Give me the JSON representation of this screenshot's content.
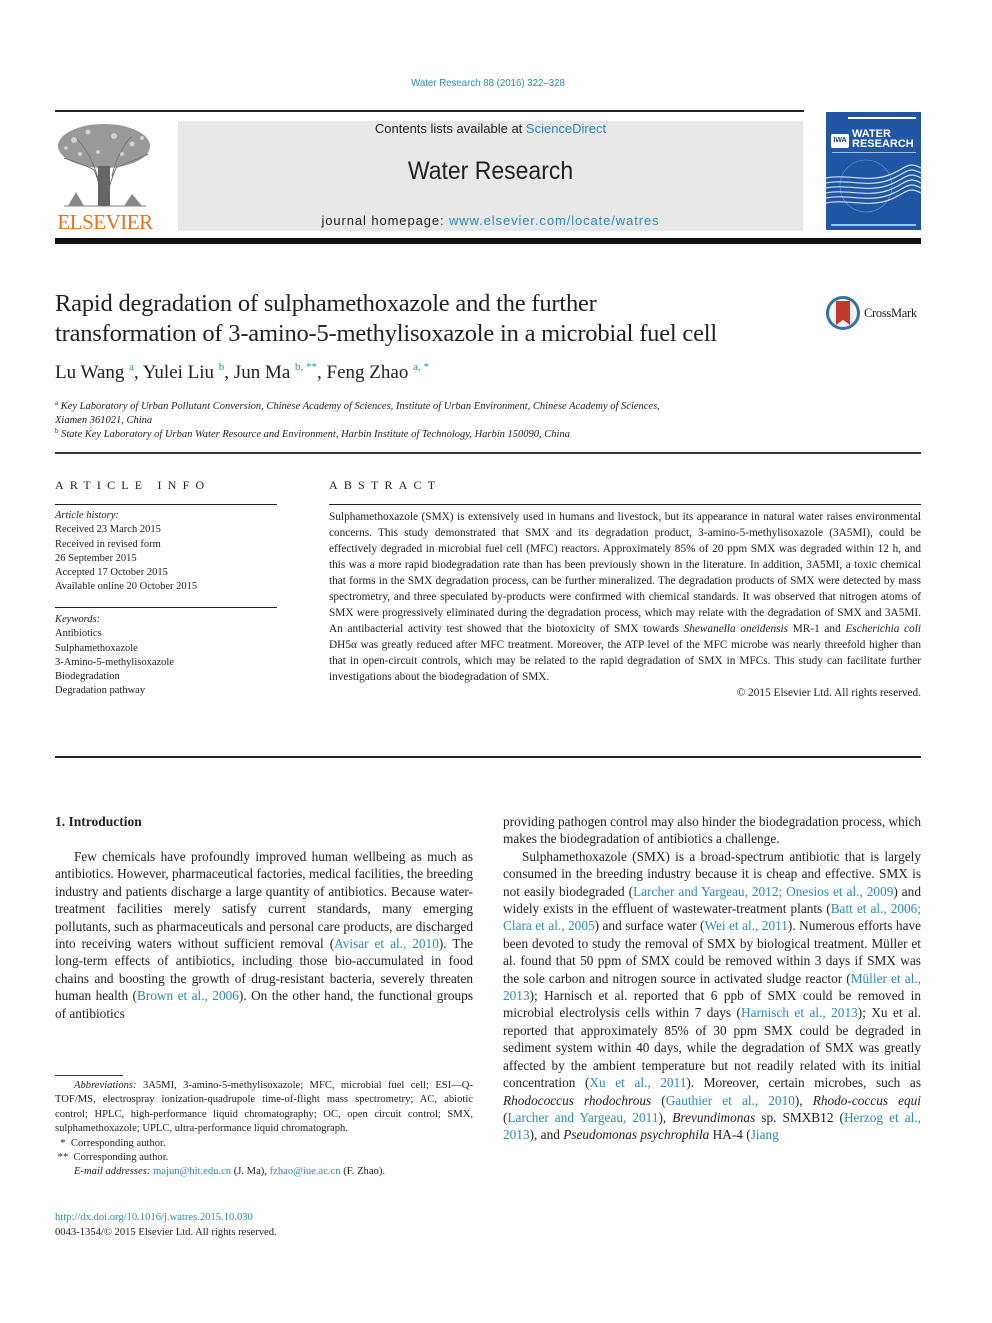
{
  "header": {
    "citation": "Water Research 88 (2016) 322–328",
    "publisher_logo_text": "ELSEVIER",
    "contents_prefix": "Contents lists available at ",
    "contents_link": "ScienceDirect",
    "journal_name": "Water Research",
    "homepage_prefix": "journal homepage: ",
    "homepage_link": "www.elsevier.com/locate/watres",
    "cover": {
      "badge": "IWA",
      "title_line1": "WATER",
      "title_line2": "RESEARCH"
    },
    "colors": {
      "link": "#2a8ab8",
      "elsevier_orange": "#e9711c",
      "cover_blue": "#2156a4",
      "box_gray": "#e8e8e8"
    }
  },
  "article": {
    "title_line1": "Rapid degradation of sulphamethoxazole and the further",
    "title_line2": "transformation of 3-amino-5-methylisoxazole in a microbial fuel cell",
    "crossmark_label": "CrossMark",
    "authors": [
      {
        "name": "Lu Wang",
        "sup": "a"
      },
      {
        "name": "Yulei Liu",
        "sup": "b"
      },
      {
        "name": "Jun Ma",
        "sup": "b, **"
      },
      {
        "name": "Feng Zhao",
        "sup": "a, *"
      }
    ],
    "affiliations": [
      {
        "mark": "a",
        "line1": "Key Laboratory of Urban Pollutant Conversion, Chinese Academy of Sciences, Institute of Urban Environment, Chinese Academy of Sciences,",
        "line2": "Xiamen 361021, China"
      },
      {
        "mark": "b",
        "line1": "State Key Laboratory of Urban Water Resource and Environment, Harbin Institute of Technology, Harbin 150090, China"
      }
    ]
  },
  "article_info": {
    "heading": "ARTICLE INFO",
    "history_label": "Article history:",
    "history": [
      "Received 23 March 2015",
      "Received in revised form",
      "26 September 2015",
      "Accepted 17 October 2015",
      "Available online 20 October 2015"
    ],
    "keywords_label": "Keywords:",
    "keywords": [
      "Antibiotics",
      "Sulphamethoxazole",
      "3-Amino-5-methylisoxazole",
      "Biodegradation",
      "Degradation pathway"
    ]
  },
  "abstract": {
    "heading": "ABSTRACT",
    "text_part1": "Sulphamethoxazole (SMX) is extensively used in humans and livestock, but its appearance in natural water raises environmental concerns. This study demonstrated that SMX and its degradation product, 3-amino-5-methylisoxazole (3A5MI), could be effectively degraded in microbial fuel cell (MFC) reactors. Approximately 85% of 20 ppm SMX was degraded within 12 h, and this was a more rapid biodegradation rate than has been previously shown in the literature. In addition, 3A5MI, a toxic chemical that forms in the SMX degradation process, can be further mineralized. The degradation products of SMX were detected by mass spectrometry, and three speculated by-products were confirmed with chemical standards. It was observed that nitrogen atoms of SMX were progressively eliminated during the degradation process, which may relate with the degradation of SMX and 3A5MI. An antibacterial activity test showed that the biotoxicity of SMX towards ",
    "species1": "Shewanella oneidensis",
    "text_part2": " MR-1 and ",
    "species2": "Escherichia coli",
    "text_part3": " DH5α was greatly reduced after MFC treatment. Moreover, the ATP level of the MFC microbe was nearly threefold higher than that in open-circuit controls, which may be related to the rapid degradation of SMX in MFCs. This study can facilitate further investigations about the biodegradation of SMX.",
    "copyright": "© 2015 Elsevier Ltd. All rights reserved."
  },
  "body": {
    "section_heading": "1.  Introduction",
    "left_p1_a": "Few chemicals have profoundly improved human wellbeing as much as antibiotics. However, pharmaceutical factories, medical facilities, the breeding industry and patients discharge a large quantity of antibiotics. Because water-treatment facilities merely satisfy current standards, many emerging pollutants, such as pharmaceuticals and personal care products, are discharged into receiving waters without sufficient removal (",
    "left_ref1": "Avisar et al., 2010",
    "left_p1_b": "). The long-term effects of antibiotics, including those bio-accumulated in food chains and boosting the growth of drug-resistant bacteria, severely threaten human health (",
    "left_ref2": "Brown et al., 2006",
    "left_p1_c": "). On the other hand, the functional groups of antibiotics",
    "right_p0": "providing pathogen control may also hinder the biodegradation process, which makes the biodegradation of antibiotics a challenge.",
    "right_p1_a": "Sulphamethoxazole (SMX) is a broad-spectrum antibiotic that is largely consumed in the breeding industry because it is cheap and effective. SMX is not easily biodegraded (",
    "right_ref1": "Larcher and Yargeau, 2012; Onesios et al., 2009",
    "right_p1_b": ") and widely exists in the effluent of wastewater-treatment plants (",
    "right_ref2": "Batt et al., 2006; Clara et al., 2005",
    "right_p1_c": ") and surface water (",
    "right_ref3": "Wei et al., 2011",
    "right_p1_d": "). Numerous efforts have been devoted to study the removal of SMX by biological treatment. Müller et al. found that 50 ppm of SMX could be removed within 3 days if SMX was the sole carbon and nitrogen source in activated sludge reactor (",
    "right_ref4": "Müller et al., 2013",
    "right_p1_e": "); Harnisch et al. reported that 6 ppb of SMX could be removed in microbial electrolysis cells within 7 days (",
    "right_ref5": "Harnisch et al., 2013",
    "right_p1_f": "); Xu et al. reported that approximately 85% of 30 ppm SMX could be degraded in sediment system within 40 days, while the degradation of SMX was greatly affected by the ambient temperature but not readily related with its initial concentration (",
    "right_ref6": "Xu et al., 2011",
    "right_p1_g": "). Moreover, certain microbes, such as ",
    "right_sp1": "Rhodococcus rhodochrous",
    "right_p1_h": " (",
    "right_ref7": "Gauthier et al., 2010",
    "right_p1_i": "), ",
    "right_sp2": "Rhodo-coccus equi",
    "right_p1_j": " (",
    "right_ref8": "Larcher and Yargeau, 2011",
    "right_p1_k": "), ",
    "right_sp3": "Brevundimonas",
    "right_p1_l": " sp. SMXB12 (",
    "right_ref9": "Herzog et al., 2013",
    "right_p1_m": "), and ",
    "right_sp4": "Pseudomonas psychrophila",
    "right_p1_n": " HA-4 (",
    "right_ref10": "Jiang"
  },
  "footnotes": {
    "abbrev_label": "Abbreviations:",
    "abbrev_text": " 3A5MI, 3-amino-5-methylisoxazole; MFC, microbial fuel cell; ESI—Q-TOF/MS, electrospray ionization-quadrupole time-of-flight mass spectrometry; AC, abiotic control; HPLC, high-performance liquid chromatography; OC, open circuit control; SMX, sulphamethoxazole; UPLC, ultra-performance liquid chromatograph.",
    "corr1": "  *  Corresponding author.",
    "corr2": " **  Corresponding author.",
    "email_label": "E-mail addresses:",
    "email1": "majun@hit.edu.cn",
    "email1_who": " (J. Ma), ",
    "email2": "fzhao@iue.ac.cn",
    "email2_who": " (F. Zhao).",
    "doi": "http://dx.doi.org/10.1016/j.watres.2015.10.030",
    "issn": "0043-1354/© 2015 Elsevier Ltd. All rights reserved."
  }
}
